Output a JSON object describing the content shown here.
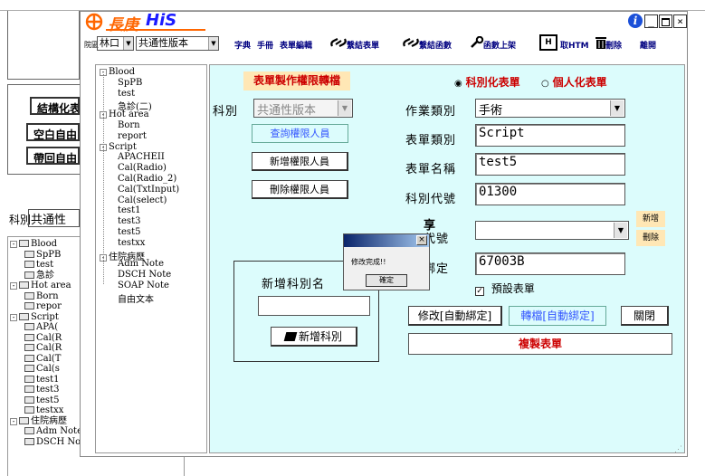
{
  "background": {
    "tabs": [
      "結構化表",
      "空白自由",
      "帶回自由"
    ],
    "dept_label": "科別",
    "dept_value": "共通性",
    "tree": [
      {
        "label": "Blood",
        "type": "folder",
        "level": 0
      },
      {
        "label": "SpPB",
        "type": "file",
        "level": 1
      },
      {
        "label": "test",
        "type": "file",
        "level": 1
      },
      {
        "label": "急診",
        "type": "file",
        "level": 1
      },
      {
        "label": "Hot area",
        "type": "folder",
        "level": 0
      },
      {
        "label": "Born",
        "type": "file",
        "level": 1
      },
      {
        "label": "repor",
        "type": "file",
        "level": 1
      },
      {
        "label": "Script",
        "type": "folder",
        "level": 0
      },
      {
        "label": "APA(",
        "type": "file",
        "level": 1
      },
      {
        "label": "Cal(R",
        "type": "file",
        "level": 1
      },
      {
        "label": "Cal(R",
        "type": "file",
        "level": 1
      },
      {
        "label": "Cal(T",
        "type": "file",
        "level": 1
      },
      {
        "label": "Cal(s",
        "type": "file",
        "level": 1
      },
      {
        "label": "test1",
        "type": "file",
        "level": 1
      },
      {
        "label": "test3",
        "type": "file",
        "level": 1
      },
      {
        "label": "test5",
        "type": "file",
        "level": 1
      },
      {
        "label": "testxx",
        "type": "file",
        "level": 1
      },
      {
        "label": "住院病歷",
        "type": "folder",
        "level": 0
      },
      {
        "label": "Adm Note",
        "type": "file",
        "level": 1
      },
      {
        "label": "DSCH Note",
        "type": "file",
        "level": 1
      }
    ]
  },
  "window": {
    "logo_text": "長庚",
    "logo_brand": "HiS",
    "info_icon": "i",
    "toolbar": {
      "branch_label": "院區",
      "branch_value": "林口",
      "version_value": "共通性版本",
      "items": [
        "字典",
        "手冊",
        "表單編輯",
        "繫結表單",
        "繫結函數",
        "函數上架",
        "取HTM",
        "刪除",
        "離開"
      ]
    }
  },
  "tree": [
    {
      "label": "Blood",
      "type": "folder"
    },
    {
      "label": "SpPB",
      "type": "leaf"
    },
    {
      "label": "test",
      "type": "leaf"
    },
    {
      "label": "急診(二)",
      "type": "leaf"
    },
    {
      "label": "Hot area",
      "type": "folder"
    },
    {
      "label": "Born",
      "type": "leaf"
    },
    {
      "label": "report",
      "type": "leaf"
    },
    {
      "label": "Script",
      "type": "folder"
    },
    {
      "label": "APACHEII",
      "type": "leaf"
    },
    {
      "label": "Cal(Radio)",
      "type": "leaf"
    },
    {
      "label": "Cal(Radio_2)",
      "type": "leaf"
    },
    {
      "label": "Cal(TxtInput)",
      "type": "leaf"
    },
    {
      "label": "Cal(select)",
      "type": "leaf"
    },
    {
      "label": "test1",
      "type": "leaf"
    },
    {
      "label": "test3",
      "type": "leaf"
    },
    {
      "label": "test5",
      "type": "leaf"
    },
    {
      "label": "testxx",
      "type": "leaf"
    },
    {
      "label": "住院病歷",
      "type": "folder"
    },
    {
      "label": "Adm Note",
      "type": "leaf"
    },
    {
      "label": "DSCH Note",
      "type": "leaf"
    },
    {
      "label": "SOAP Note",
      "type": "leaf"
    },
    {
      "label": "自由文本",
      "type": "leaf"
    }
  ],
  "panel": {
    "title": "表單製作權限轉檔",
    "radio_dept": "科別化表單",
    "radio_personal": "個人化表單",
    "dept_label": "科別",
    "dept_value": "共通性版本",
    "btn_query": "查詢權限人員",
    "btn_add_perm": "新增權限人員",
    "btn_del_perm": "刪除權限人員",
    "work_type_label": "作業類別",
    "work_type_value": "手術",
    "form_type_label": "表單類別",
    "form_type_value": "Script",
    "form_name_label": "表單名稱",
    "form_name_value": "test5",
    "dept_code_label": "科別代號",
    "dept_code_value": "01300",
    "item_label_top": "享",
    "item_label_bottom": "代號",
    "item_value": "",
    "btn_new_small": "新增",
    "btn_del_small": "刪除",
    "bind_label": "綁定",
    "bind_value": "67003B",
    "default_form_label": "預設表單",
    "add_dept_title": "新增科別名",
    "add_dept_input": "",
    "btn_add_dept": "新增科別",
    "btn_modify": "修改[自動綁定]",
    "btn_convert": "轉檔[自動綁定]",
    "btn_close": "關閉",
    "btn_copy": "複製表單"
  },
  "dialog": {
    "message": "修改完成!!",
    "ok": "確定",
    "close": "×"
  },
  "colors": {
    "panel_bg": "#dcfcfc",
    "logo_orange": "#ff6600",
    "logo_blue": "#1a1aff",
    "red_text": "#cc0000",
    "small_btn_bg": "#ffe7b5"
  }
}
